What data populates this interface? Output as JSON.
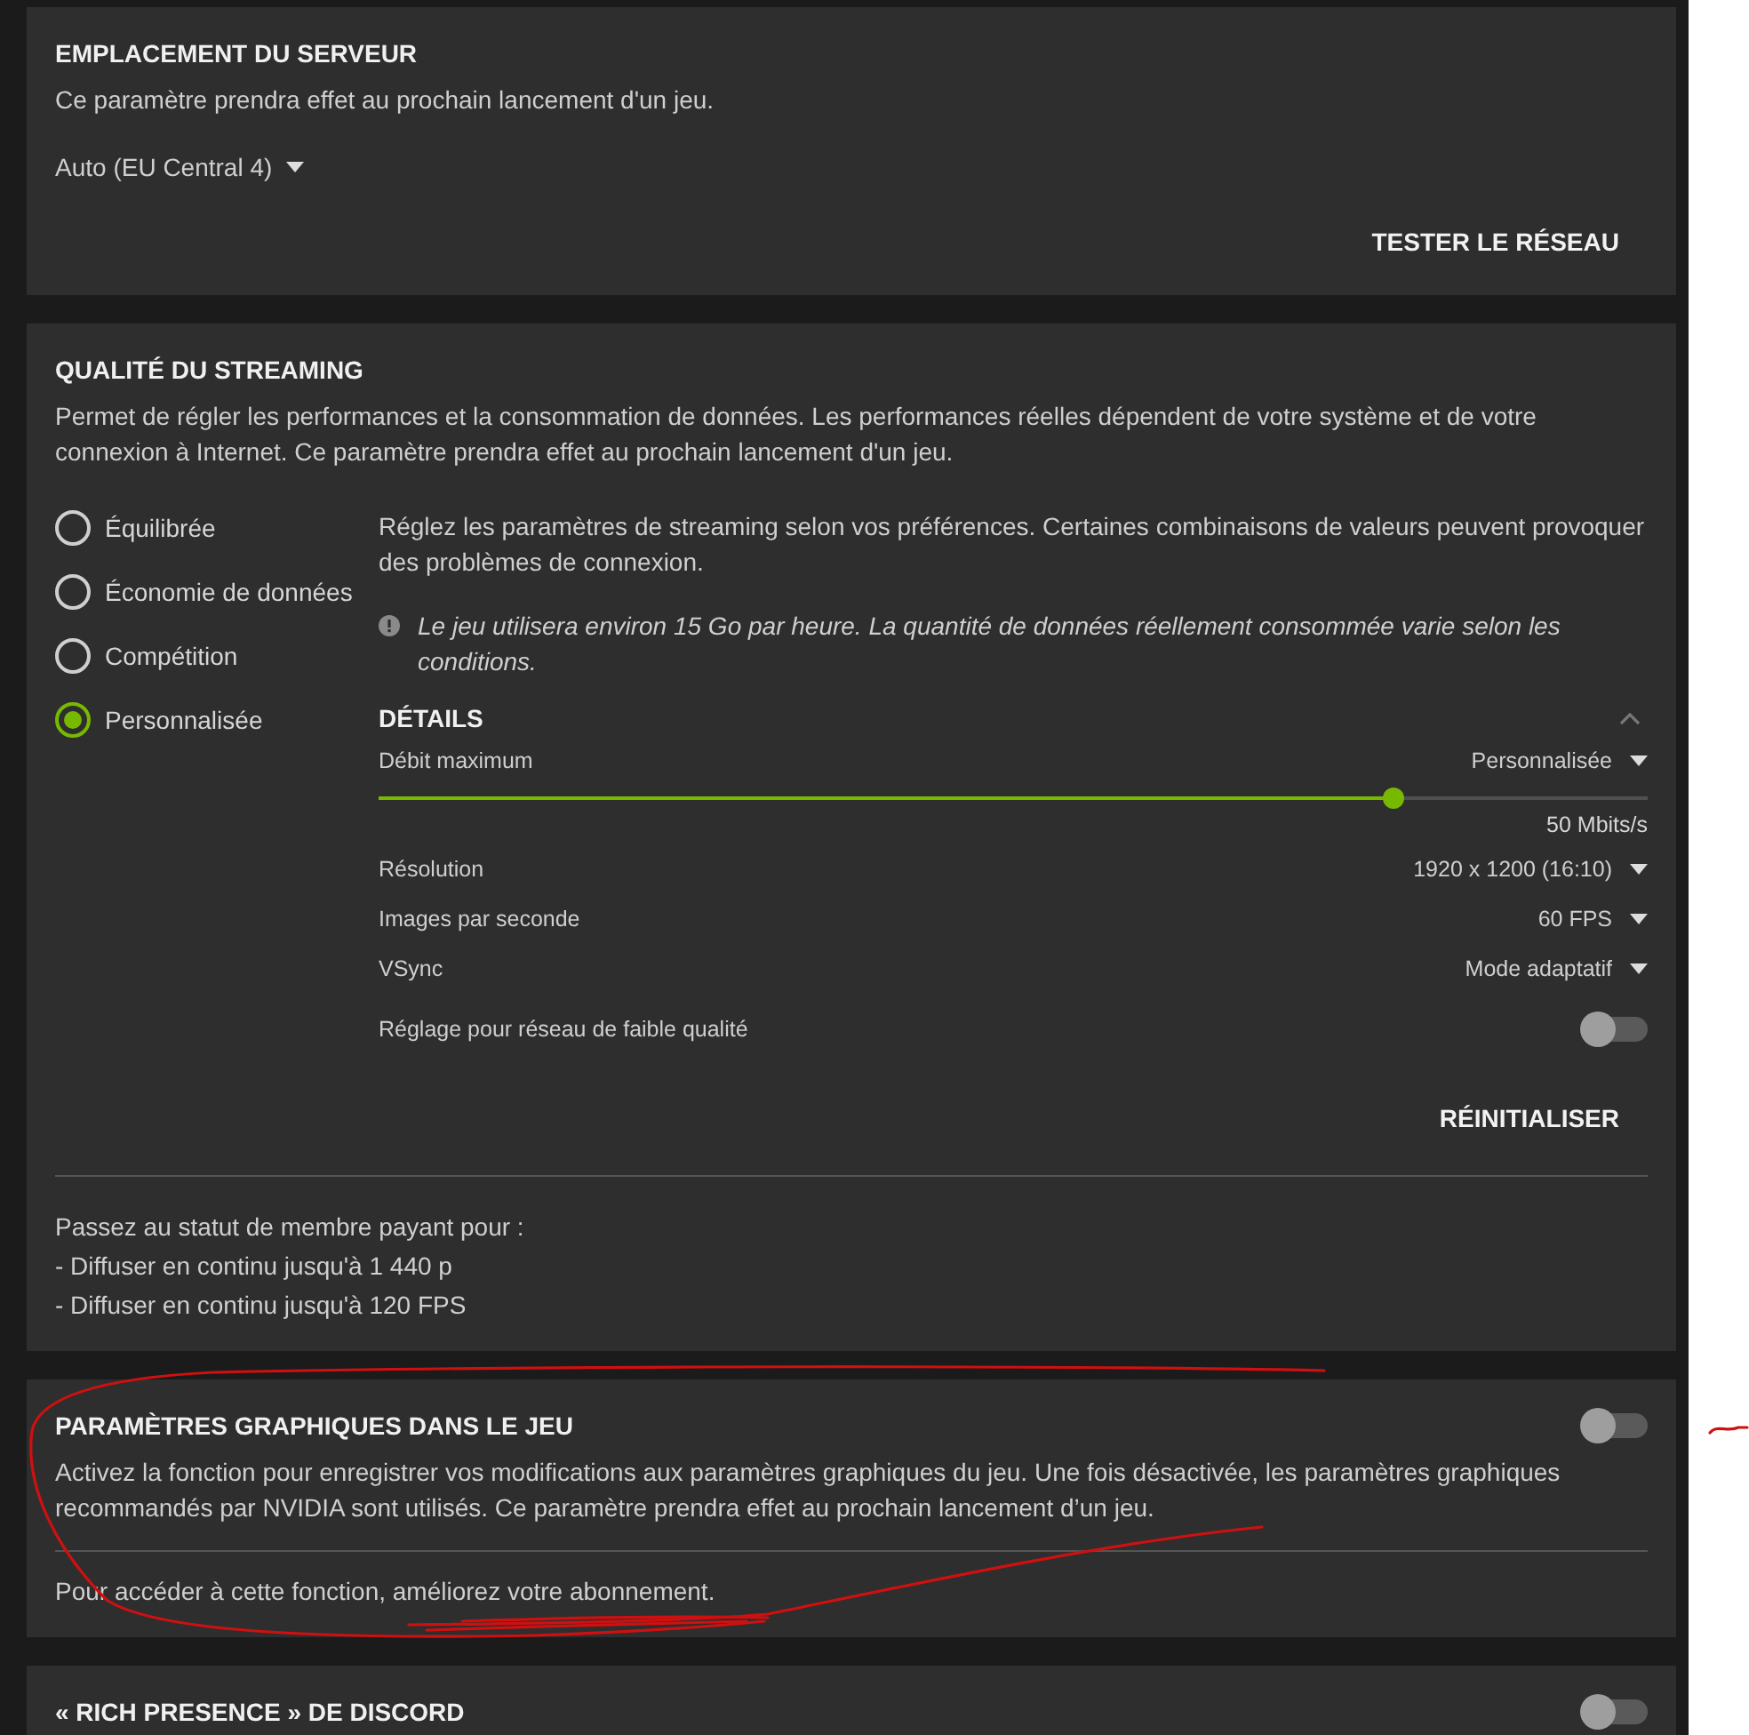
{
  "server_location": {
    "title": "EMPLACEMENT DU SERVEUR",
    "description": "Ce paramètre prendra effet au prochain lancement d'un jeu.",
    "dropdown": {
      "value": "Auto (EU Central 4)"
    },
    "button": "TESTER LE RÉSEAU"
  },
  "streaming_quality": {
    "title": "QUALITÉ DU STREAMING",
    "description": "Permet de régler les performances et la consommation de données. Les performances réelles dépendent de votre système et de votre connexion à Internet. Ce paramètre prendra effet au prochain lancement d'un jeu.",
    "presets": [
      {
        "label": "Équilibrée",
        "selected": false
      },
      {
        "label": "Économie de données",
        "selected": false
      },
      {
        "label": "Compétition",
        "selected": false
      },
      {
        "label": "Personnalisée",
        "selected": true
      }
    ],
    "intro": "Réglez les paramètres de streaming selon vos préférences. Certaines combinaisons de valeurs peuvent provoquer des problèmes de connexion.",
    "notice": "Le jeu utilisera environ 15 Go par heure. La quantité de données réellement consommée varie selon les conditions.",
    "details": {
      "title": "DÉTAILS",
      "expanded": true,
      "settings": [
        {
          "kind": "slider",
          "label": "Débit maximum",
          "value": "Personnalisée",
          "reading": "50 Mbits/s",
          "level": 0.8
        },
        {
          "kind": "dropdown",
          "label": "Résolution",
          "value": "1920 x 1200 (16:10)"
        },
        {
          "kind": "dropdown",
          "label": "Images par seconde",
          "value": "60 FPS"
        },
        {
          "kind": "dropdown",
          "label": "VSync",
          "value": "Mode adaptatif"
        },
        {
          "kind": "toggle",
          "label": "Réglage pour réseau de faible qualité",
          "on": false
        }
      ]
    },
    "reset_button": "RÉINITIALISER",
    "upgrade": {
      "title": "Passez au statut de membre payant pour :",
      "items": [
        "- Diffuser en continu jusqu'à 1 440 p",
        "- Diffuser en continu jusqu'à 120 FPS"
      ]
    }
  },
  "in_game_graphics": {
    "title": "PARAMÈTRES GRAPHIQUES DANS LE JEU",
    "on": false,
    "description": "Activez la fonction pour enregistrer vos modifications aux paramètres graphiques du jeu. Une fois désactivée, les paramètres graphiques recommandés par NVIDIA sont utilisés. Ce paramètre prendra effet au prochain lancement d’un jeu.",
    "note": "Pour accéder à cette fonction, améliorez votre abonnement."
  },
  "discord": {
    "title": "« RICH PRESENCE » DE DISCORD",
    "on": false
  }
}
